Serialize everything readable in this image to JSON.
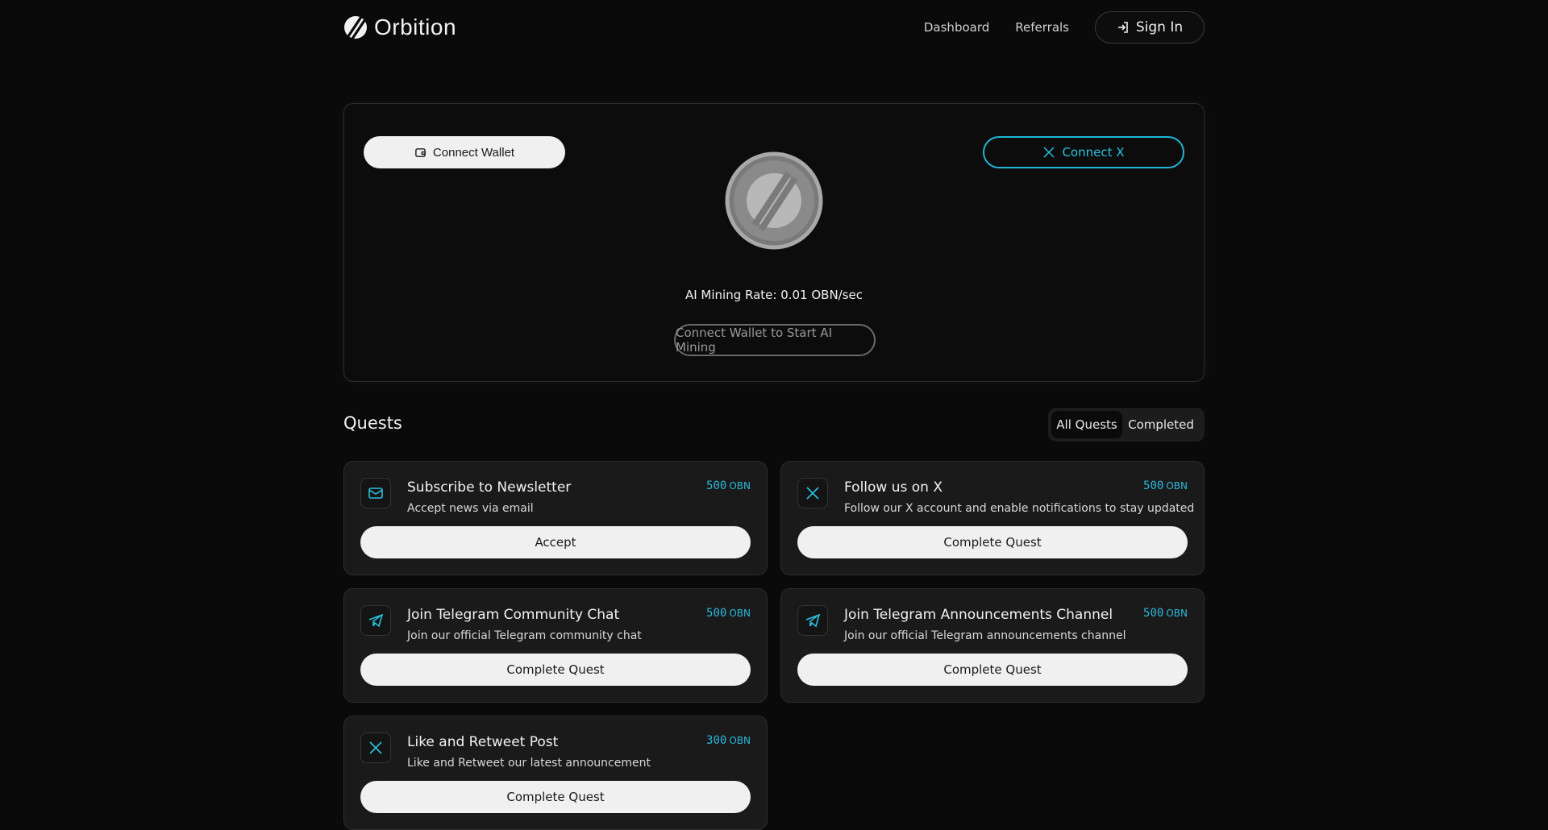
{
  "header": {
    "brand": "Orbition",
    "nav": [
      {
        "label": "Dashboard"
      },
      {
        "label": "Referrals"
      }
    ],
    "signin_label": "Sign In"
  },
  "mining": {
    "connect_wallet_label": "Connect Wallet",
    "connect_x_label": "Connect X",
    "rate_text": "AI Mining Rate: 0.01 OBN/sec",
    "start_label": "Connect Wallet to Start AI Mining"
  },
  "quests": {
    "title": "Quests",
    "tabs": [
      {
        "label": "All Quests",
        "active": true
      },
      {
        "label": "Completed",
        "active": false
      }
    ],
    "items": [
      {
        "icon": "mail-icon",
        "title": "Subscribe to Newsletter",
        "desc": "Accept news via email",
        "points": "500",
        "unit": "OBN",
        "button": "Accept"
      },
      {
        "icon": "x-logo-icon",
        "title": "Follow us on X",
        "desc": "Follow our X account and enable notifications to stay updated",
        "points": "500",
        "unit": "OBN",
        "button": "Complete Quest"
      },
      {
        "icon": "telegram-icon",
        "title": "Join Telegram Community Chat",
        "desc": "Join our official Telegram community chat",
        "points": "500",
        "unit": "OBN",
        "button": "Complete Quest"
      },
      {
        "icon": "telegram-icon",
        "title": "Join Telegram Announcements Channel",
        "desc": "Join our official Telegram announcements channel",
        "points": "500",
        "unit": "OBN",
        "button": "Complete Quest"
      },
      {
        "icon": "x-logo-icon",
        "title": "Like and Retweet Post",
        "desc": "Like and Retweet our latest announcement",
        "points": "300",
        "unit": "OBN",
        "button": "Complete Quest"
      }
    ]
  },
  "colors": {
    "accent": "#28c2e0",
    "background": "#0a0a0a",
    "card": "#1a1a1a"
  }
}
